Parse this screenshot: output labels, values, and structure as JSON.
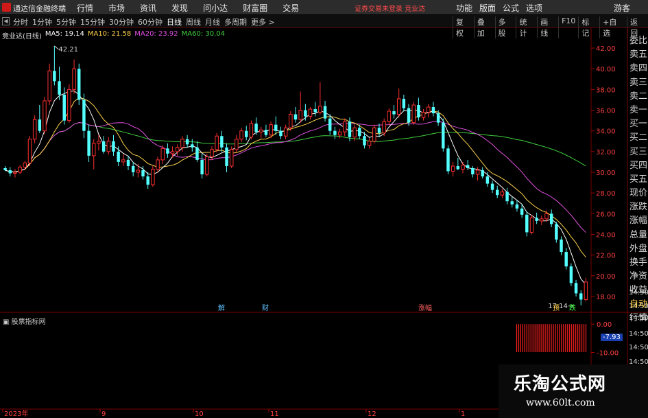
{
  "titlebar": {
    "app_title": "通达信金融终端",
    "menu": [
      "行情",
      "市场",
      "资讯",
      "发现",
      "问小达",
      "财富圈",
      "交易"
    ],
    "notice": "证券交易未登录  竞业达",
    "right": [
      "功能",
      "版面",
      "公式",
      "选项"
    ],
    "guest": "游客"
  },
  "toolbar": {
    "periods": [
      "分时",
      "1分钟",
      "5分钟",
      "15分钟",
      "30分钟",
      "60分钟",
      "日线",
      "周线",
      "月线",
      "多周期",
      "更多 >"
    ],
    "active_period": "日线",
    "right": [
      "复权",
      "叠加",
      "多股",
      "统计",
      "画线",
      "F10",
      "标记",
      "+自选",
      "返回"
    ]
  },
  "chart": {
    "stock_name": "竞业达(日线)",
    "ma": [
      {
        "label": "MA5:",
        "value": "19.14",
        "color": "#ffffff"
      },
      {
        "label": "MA10:",
        "value": "21.58",
        "color": "#ffd24a"
      },
      {
        "label": "MA20:",
        "value": "23.92",
        "color": "#e050e0"
      },
      {
        "label": "MA60:",
        "value": "30.04",
        "color": "#40d040"
      }
    ],
    "high_label": "42.21",
    "low_label": "17.14",
    "price_ticks": [
      "42.00",
      "40.00",
      "38.00",
      "36.00",
      "34.00",
      "32.00",
      "30.00",
      "28.00",
      "26.00",
      "24.00",
      "22.00",
      "20.00",
      "18.00"
    ],
    "event_marks": [
      {
        "text": "解",
        "color": "#60c0ff"
      },
      {
        "text": "财",
        "color": "#60c0ff"
      },
      {
        "text": "涨幅",
        "color": "#ff6060"
      },
      {
        "text": "预",
        "color": "#ffd24a"
      },
      {
        "text": "跌",
        "color": "#40ff40"
      }
    ],
    "x_labels": [
      "2023年",
      "9",
      "10",
      "11",
      "12",
      "1"
    ],
    "time_labels": [
      "14:50",
      "14:50",
      "14:50",
      "14:50",
      "14:50",
      "14:50"
    ]
  },
  "right_tabs": [
    "委比",
    "卖五",
    "卖四",
    "卖三",
    "卖二",
    "卖一",
    "买一",
    "买二",
    "买三",
    "买四",
    "买五",
    "现价",
    "涨跌",
    "涨幅",
    "总量",
    "外盘",
    "换手",
    "净资",
    "收益",
    "自动",
    "行情"
  ],
  "indicator": {
    "title": "股票指标网",
    "ticks": [
      "0.00",
      "-10.00"
    ],
    "current_value": "-7.93"
  },
  "watermark": {
    "title": "乐淘公式网",
    "url": "www.60lt.com"
  },
  "chart_data": {
    "type": "candlestick",
    "ylim": [
      17,
      43
    ],
    "up_color": "#ff3030",
    "down_color": "#54ffff",
    "candles": [
      [
        30.4,
        30.6,
        30.1,
        30.2
      ],
      [
        30.2,
        30.5,
        29.6,
        29.9
      ],
      [
        29.9,
        30.3,
        29.5,
        30.0
      ],
      [
        30.0,
        30.7,
        29.8,
        30.5
      ],
      [
        30.5,
        31.1,
        30.2,
        30.9
      ],
      [
        30.9,
        33.5,
        30.6,
        33.2
      ],
      [
        33.2,
        35.5,
        32.8,
        35.1
      ],
      [
        35.1,
        36.5,
        33.8,
        34.0
      ],
      [
        34.0,
        37.3,
        33.7,
        36.9
      ],
      [
        36.9,
        40.5,
        36.5,
        39.8
      ],
      [
        39.8,
        42.21,
        38.4,
        38.8
      ],
      [
        38.8,
        40.2,
        37.0,
        37.5
      ],
      [
        37.5,
        38.2,
        34.6,
        35.0
      ],
      [
        35.0,
        38.5,
        34.8,
        38.0
      ],
      [
        38.0,
        40.9,
        37.6,
        40.0
      ],
      [
        40.0,
        40.5,
        36.5,
        37.0
      ],
      [
        37.0,
        37.6,
        33.3,
        34.0
      ],
      [
        34.0,
        34.6,
        31.0,
        31.6
      ],
      [
        31.6,
        33.2,
        30.3,
        32.8
      ],
      [
        32.8,
        33.6,
        32.1,
        33.0
      ],
      [
        33.0,
        33.5,
        31.8,
        32.0
      ],
      [
        32.0,
        33.4,
        31.7,
        33.0
      ],
      [
        33.0,
        33.6,
        31.6,
        32.0
      ],
      [
        32.0,
        32.5,
        30.6,
        31.0
      ],
      [
        31.0,
        31.8,
        30.6,
        31.2
      ],
      [
        31.2,
        31.6,
        30.2,
        30.6
      ],
      [
        30.6,
        31.0,
        29.6,
        30.0
      ],
      [
        30.0,
        30.8,
        29.5,
        30.2
      ],
      [
        30.2,
        30.6,
        29.3,
        29.6
      ],
      [
        29.6,
        30.0,
        28.4,
        28.8
      ],
      [
        28.8,
        30.6,
        28.6,
        30.3
      ],
      [
        30.3,
        31.5,
        30.0,
        31.2
      ],
      [
        31.2,
        32.6,
        30.8,
        32.3
      ],
      [
        32.3,
        32.8,
        31.4,
        31.8
      ],
      [
        31.8,
        32.5,
        31.4,
        32.0
      ],
      [
        32.0,
        32.7,
        31.6,
        32.4
      ],
      [
        32.4,
        33.5,
        32.0,
        33.2
      ],
      [
        33.2,
        33.6,
        32.4,
        32.7
      ],
      [
        32.7,
        33.2,
        32.0,
        32.4
      ],
      [
        32.4,
        33.0,
        31.0,
        31.2
      ],
      [
        31.2,
        31.8,
        29.4,
        29.8
      ],
      [
        29.8,
        31.8,
        29.6,
        31.5
      ],
      [
        31.5,
        32.5,
        31.2,
        32.2
      ],
      [
        32.2,
        33.8,
        31.9,
        33.5
      ],
      [
        33.5,
        34.0,
        32.0,
        32.4
      ],
      [
        32.4,
        32.8,
        30.0,
        30.6
      ],
      [
        30.6,
        32.5,
        30.4,
        32.2
      ],
      [
        32.2,
        33.6,
        31.9,
        33.2
      ],
      [
        33.2,
        34.3,
        32.9,
        34.0
      ],
      [
        34.0,
        34.5,
        33.1,
        33.4
      ],
      [
        33.4,
        35.0,
        33.2,
        34.7
      ],
      [
        34.7,
        35.3,
        33.6,
        33.9
      ],
      [
        33.9,
        34.4,
        33.3,
        34.1
      ],
      [
        34.1,
        34.6,
        33.4,
        33.6
      ],
      [
        33.6,
        34.9,
        33.3,
        34.6
      ],
      [
        34.6,
        35.4,
        33.6,
        34.0
      ],
      [
        34.0,
        34.4,
        33.2,
        33.5
      ],
      [
        33.5,
        34.6,
        33.2,
        34.3
      ],
      [
        34.3,
        35.9,
        34.0,
        35.6
      ],
      [
        35.6,
        36.3,
        34.8,
        35.1
      ],
      [
        35.1,
        37.8,
        34.8,
        36.0
      ],
      [
        36.0,
        36.6,
        35.0,
        35.4
      ],
      [
        35.4,
        36.3,
        35.1,
        36.1
      ],
      [
        36.1,
        36.8,
        35.4,
        35.8
      ],
      [
        35.8,
        38.7,
        35.6,
        36.4
      ],
      [
        36.4,
        36.9,
        34.9,
        35.2
      ],
      [
        35.2,
        35.6,
        33.6,
        34.0
      ],
      [
        34.0,
        34.4,
        33.2,
        33.6
      ],
      [
        33.6,
        34.2,
        33.3,
        33.9
      ],
      [
        33.9,
        35.2,
        33.5,
        34.9
      ],
      [
        34.9,
        35.3,
        33.0,
        33.4
      ],
      [
        33.4,
        34.6,
        33.0,
        34.3
      ],
      [
        34.3,
        34.6,
        33.2,
        33.5
      ],
      [
        33.5,
        33.9,
        32.3,
        32.6
      ],
      [
        32.6,
        33.3,
        32.3,
        33.0
      ],
      [
        33.0,
        34.6,
        32.8,
        34.3
      ],
      [
        34.3,
        34.7,
        33.4,
        33.8
      ],
      [
        33.8,
        35.2,
        33.5,
        34.9
      ],
      [
        34.9,
        36.2,
        34.6,
        35.9
      ],
      [
        35.9,
        36.5,
        35.2,
        35.6
      ],
      [
        35.6,
        38.1,
        35.3,
        37.1
      ],
      [
        37.1,
        37.5,
        35.9,
        36.2
      ],
      [
        36.2,
        36.6,
        34.5,
        34.8
      ],
      [
        34.8,
        36.8,
        34.6,
        36.5
      ],
      [
        36.5,
        37.2,
        35.0,
        35.3
      ],
      [
        35.3,
        36.1,
        35.0,
        35.8
      ],
      [
        35.8,
        36.6,
        35.3,
        36.3
      ],
      [
        36.3,
        36.8,
        35.4,
        35.7
      ],
      [
        35.7,
        36.0,
        34.5,
        34.8
      ],
      [
        34.8,
        35.2,
        32.0,
        32.3
      ],
      [
        32.3,
        32.6,
        29.8,
        30.1
      ],
      [
        30.1,
        31.0,
        29.6,
        30.6
      ],
      [
        30.6,
        31.4,
        30.2,
        30.3
      ],
      [
        30.3,
        31.0,
        29.9,
        30.7
      ],
      [
        30.7,
        31.2,
        30.2,
        30.4
      ],
      [
        30.4,
        30.6,
        29.5,
        29.8
      ],
      [
        29.8,
        30.5,
        29.2,
        30.2
      ],
      [
        30.2,
        30.5,
        29.4,
        29.6
      ],
      [
        29.6,
        30.0,
        28.6,
        28.9
      ],
      [
        28.9,
        29.2,
        28.0,
        28.3
      ],
      [
        28.3,
        28.7,
        27.5,
        27.8
      ],
      [
        27.8,
        28.4,
        27.5,
        28.1
      ],
      [
        28.1,
        28.5,
        26.9,
        27.2
      ],
      [
        27.2,
        27.6,
        26.6,
        26.9
      ],
      [
        26.9,
        27.3,
        26.2,
        26.5
      ],
      [
        26.5,
        26.9,
        25.6,
        25.9
      ],
      [
        25.9,
        26.2,
        23.8,
        24.2
      ],
      [
        24.2,
        25.9,
        24.0,
        25.6
      ],
      [
        25.6,
        26.1,
        25.0,
        25.3
      ],
      [
        25.3,
        25.8,
        24.9,
        25.5
      ],
      [
        25.5,
        26.3,
        25.2,
        26.0
      ],
      [
        26.0,
        26.4,
        24.7,
        25.0
      ],
      [
        25.0,
        25.2,
        23.2,
        23.5
      ],
      [
        23.5,
        23.8,
        22.0,
        22.3
      ],
      [
        22.3,
        22.7,
        20.6,
        20.9
      ],
      [
        20.9,
        21.2,
        19.0,
        19.3
      ],
      [
        19.3,
        19.6,
        18.0,
        18.3
      ],
      [
        18.3,
        18.6,
        17.14,
        17.7
      ],
      [
        17.7,
        19.8,
        17.5,
        19.4
      ]
    ],
    "indicator": {
      "ylim": [
        -13.5,
        1.5
      ],
      "bars": [
        -7.93,
        -7.93,
        -7.93,
        -7.93,
        -7.93,
        -7.93,
        -7.93,
        -7.93,
        -7.93,
        -7.93,
        -7.93,
        -7.93,
        -7.93,
        -7.93,
        -7.93,
        -7.93,
        -7.93,
        -7.93,
        -7.93,
        -7.93,
        -7.93,
        -7.93,
        -7.93,
        -7.93,
        -7.93,
        -7.93,
        -7.93,
        -7.93,
        -7.93,
        -7.93,
        -7.93,
        -7.93,
        -7.93,
        -7.93,
        -7.93
      ]
    }
  }
}
